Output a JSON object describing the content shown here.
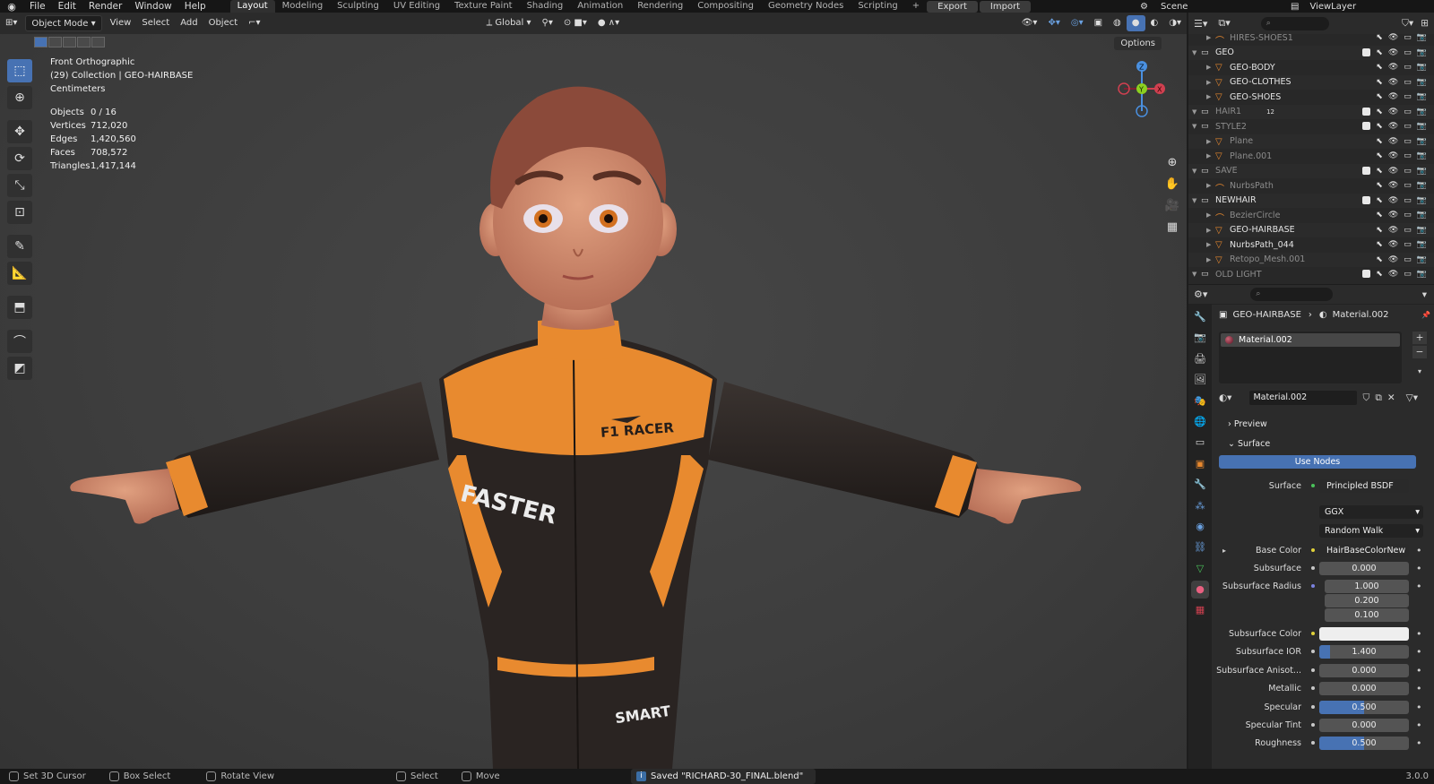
{
  "menu": [
    "File",
    "Edit",
    "Render",
    "Window",
    "Help"
  ],
  "workspaces": [
    {
      "label": "Layout",
      "active": true
    },
    {
      "label": "Modeling"
    },
    {
      "label": "Sculpting"
    },
    {
      "label": "UV Editing"
    },
    {
      "label": "Texture Paint"
    },
    {
      "label": "Shading"
    },
    {
      "label": "Animation"
    },
    {
      "label": "Rendering"
    },
    {
      "label": "Compositing"
    },
    {
      "label": "Geometry Nodes"
    },
    {
      "label": "Scripting"
    }
  ],
  "topbar": {
    "add_tab": "+",
    "export": "Export",
    "import": "Import",
    "scene": "Scene",
    "view_layer": "ViewLayer"
  },
  "viewport_header": {
    "mode": "Object Mode",
    "menus": [
      "View",
      "Select",
      "Add",
      "Object"
    ],
    "transform": "Global",
    "options": "Options"
  },
  "viewport": {
    "view_name": "Front Orthographic",
    "collection": "(29) Collection | GEO-HAIRBASE",
    "units": "Centimeters",
    "stats": [
      {
        "label": "Objects",
        "value": "0 / 16"
      },
      {
        "label": "Vertices",
        "value": "712,020"
      },
      {
        "label": "Edges",
        "value": "1,420,560"
      },
      {
        "label": "Faces",
        "value": "708,572"
      },
      {
        "label": "Triangles",
        "value": "1,417,144"
      }
    ],
    "suit_text_1": "F1 RACER",
    "suit_text_2": "FASTER",
    "suit_text_3": "SMART",
    "gizmo": {
      "x": "X",
      "y": "Y",
      "z": "Z"
    }
  },
  "outliner": {
    "rows": [
      {
        "name": "HIRES-SHOES1",
        "indent": 2,
        "dim": true
      },
      {
        "name": "GEO",
        "indent": 1,
        "collection": true
      },
      {
        "name": "GEO-BODY",
        "indent": 2,
        "mesh": true
      },
      {
        "name": "GEO-CLOTHES",
        "indent": 2,
        "mesh": true
      },
      {
        "name": "GEO-SHOES",
        "indent": 2,
        "mesh": true
      },
      {
        "name": "HAIR1",
        "indent": 1,
        "dim": true,
        "collection": true
      },
      {
        "name": "STYLE2",
        "indent": 1,
        "dim": true,
        "collection": true
      },
      {
        "name": "Plane",
        "indent": 2,
        "dim": true,
        "mesh": true
      },
      {
        "name": "Plane.001",
        "indent": 2,
        "dim": true,
        "mesh": true
      },
      {
        "name": "SAVE",
        "indent": 1,
        "dim": true,
        "collection": true
      },
      {
        "name": "NurbsPath",
        "indent": 2,
        "dim": true
      },
      {
        "name": "NEWHAIR",
        "indent": 1,
        "collection": true
      },
      {
        "name": "BezierCircle",
        "indent": 2,
        "dim": true
      },
      {
        "name": "GEO-HAIRBASE",
        "indent": 2,
        "mesh": true
      },
      {
        "name": "NurbsPath_044",
        "indent": 2,
        "mesh": true
      },
      {
        "name": "Retopo_Mesh.001",
        "indent": 2,
        "dim": true,
        "mesh": true
      },
      {
        "name": "OLD LIGHT",
        "indent": 1,
        "dim": true,
        "collection": true
      }
    ],
    "hair_count": "12"
  },
  "properties": {
    "object": "GEO-HAIRBASE",
    "material": "Material.002",
    "slot": "Material.002",
    "material_field": "Material.002",
    "preview_label": "Preview",
    "surface_label": "Surface",
    "use_nodes": "Use Nodes",
    "surface_shader": "Principled BSDF",
    "distribution": "GGX",
    "subsurface_method": "Random Walk",
    "rows": [
      {
        "label": "Base Color",
        "value": "HairBaseColorNew",
        "type": "link"
      },
      {
        "label": "Subsurface",
        "value": "0.000",
        "fill": 0
      },
      {
        "label": "Subsurface Radius",
        "value": "1.000",
        "fill": 0
      },
      {
        "label": "",
        "value": "0.200",
        "fill": 0
      },
      {
        "label": "",
        "value": "0.100",
        "fill": 0
      },
      {
        "label": "Subsurface Color",
        "value": "",
        "type": "color"
      },
      {
        "label": "Subsurface IOR",
        "value": "1.400",
        "fill": 0.12
      },
      {
        "label": "Subsurface Anisot...",
        "value": "0.000",
        "fill": 0
      },
      {
        "label": "Metallic",
        "value": "0.000",
        "fill": 0
      },
      {
        "label": "Specular",
        "value": "0.500",
        "fill": 0.5
      },
      {
        "label": "Specular Tint",
        "value": "0.000",
        "fill": 0
      },
      {
        "label": "Roughness",
        "value": "0.500",
        "fill": 0.5
      }
    ]
  },
  "statusbar": {
    "items": [
      "Set 3D Cursor",
      "Box Select",
      "Rotate View",
      "Select",
      "Move"
    ],
    "saved": "Saved \"RICHARD-30_FINAL.blend\"",
    "version": "3.0.0"
  },
  "colors": {
    "accent": "#4772b3",
    "suit_orange": "#e8882e",
    "suit_black": "#2a2422",
    "skin": "#d59070",
    "hair": "#8b4a3a"
  }
}
